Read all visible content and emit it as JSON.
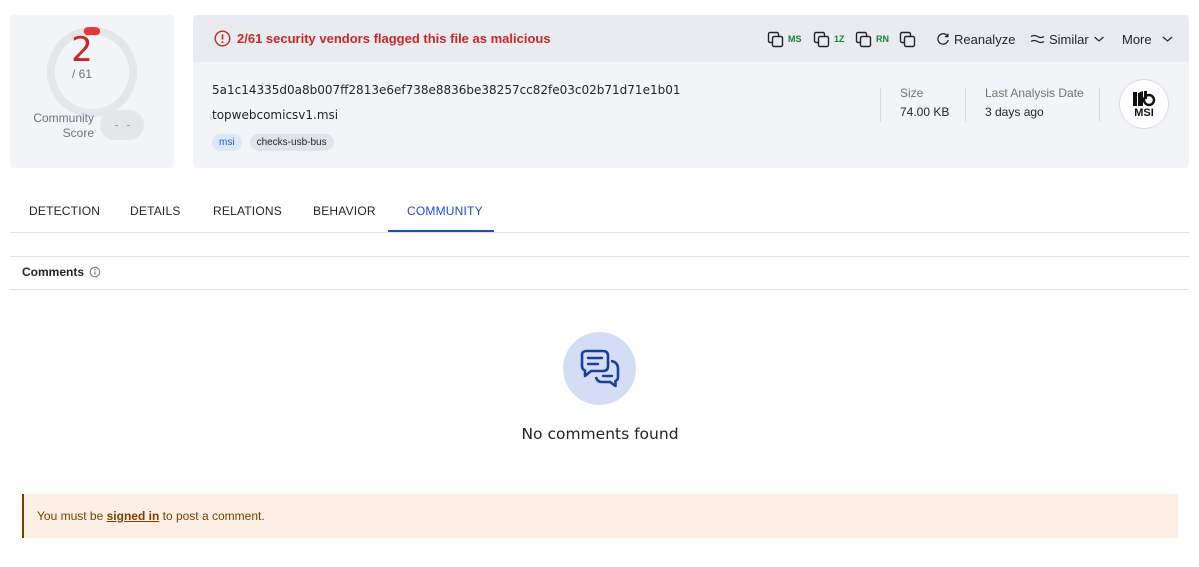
{
  "score": {
    "detections": "2",
    "total": "/ 61",
    "community_label": "Community Score",
    "gauge_fraction": 0.0328,
    "gauge_color": "#e53935"
  },
  "alert": {
    "text": "2/61 security vendors flagged this file as malicious",
    "icon": "alert-circle-icon",
    "color": "#c62828"
  },
  "actions": {
    "copy_ms_badge": "MS",
    "copy_1z_badge": "1Z",
    "copy_rn_badge": "RN",
    "reanalyze_label": "Reanalyze",
    "similar_label": "Similar",
    "more_label": "More"
  },
  "file": {
    "hash": "5a1c14335d0a8b007ff2813e6ef738e8836be38257cc82fe03c02b71d71e1b01",
    "name": "topwebcomicsv1.msi",
    "tags": [
      "msi",
      "checks-usb-bus"
    ],
    "size_label": "Size",
    "size_value": "74.00 KB",
    "date_label": "Last Analysis Date",
    "date_value": "3 days ago",
    "type_logo_text": "MSI"
  },
  "tabs": [
    {
      "label": "DETECTION"
    },
    {
      "label": "DETAILS"
    },
    {
      "label": "RELATIONS"
    },
    {
      "label": "BEHAVIOR"
    },
    {
      "label": "COMMUNITY",
      "active": true
    }
  ],
  "comments": {
    "title": "Comments",
    "empty_text": "No comments found",
    "notice_prefix": "You must be ",
    "notice_link": "signed in",
    "notice_suffix": " to post a comment."
  },
  "colors": {
    "accent": "#1a4fc7",
    "malicious": "#c62828",
    "notice_bg": "#fcefe3",
    "notice_text": "#7a3e00"
  }
}
